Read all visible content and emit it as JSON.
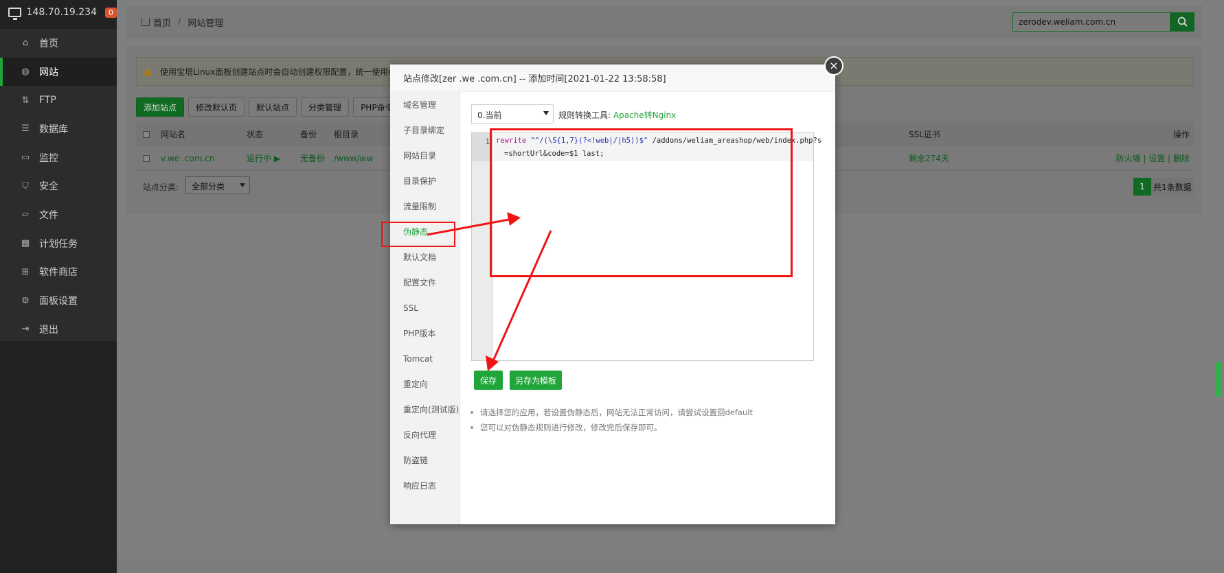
{
  "sidebar": {
    "server_ip": "148.70.19.234",
    "badge": "0",
    "items": [
      {
        "label": "首页",
        "icon": "home-icon"
      },
      {
        "label": "网站",
        "icon": "globe-icon"
      },
      {
        "label": "FTP",
        "icon": "ftp-icon"
      },
      {
        "label": "数据库",
        "icon": "database-icon"
      },
      {
        "label": "监控",
        "icon": "monitor-icon"
      },
      {
        "label": "安全",
        "icon": "shield-icon"
      },
      {
        "label": "文件",
        "icon": "folder-icon"
      },
      {
        "label": "计划任务",
        "icon": "calendar-icon"
      },
      {
        "label": "软件商店",
        "icon": "grid-icon"
      },
      {
        "label": "面板设置",
        "icon": "settings-icon"
      },
      {
        "label": "退出",
        "icon": "logout-icon"
      }
    ],
    "active_item": "网站"
  },
  "header": {
    "breadcrumb_home": "首页",
    "breadcrumb_sep": "/",
    "breadcrumb_current": "网站管理",
    "search_value": "zerodev.weliam.com.cn"
  },
  "main": {
    "warning": "使用宝塔Linux面板创建站点时会自动创建权限配置，统一使用www用",
    "toolbar": [
      "添加站点",
      "修改默认页",
      "默认站点",
      "分类管理",
      "PHP命令行版本"
    ],
    "table_headers": {
      "name": "网站名",
      "status": "状态",
      "backup": "备份",
      "root": "根目录",
      "ssl": "SSL证书",
      "actions": "操作"
    },
    "row": {
      "name": "v.we   .com.cn",
      "status": "运行中 ▶",
      "backup": "无备份",
      "root": "/www/ww",
      "ssl": "剩余274天",
      "actions": "防火墙 | 设置 | 删除"
    },
    "category_label": "站点分类:",
    "category_value": "全部分类",
    "page_number": "1",
    "total": "共1条数据"
  },
  "modal": {
    "title": "站点修改[zer      .we     .com.cn] -- 添加时间[2021-01-22 13:58:58]",
    "close": "×",
    "nav": [
      "域名管理",
      "子目录绑定",
      "网站目录",
      "目录保护",
      "流量限制",
      "伪静态",
      "默认文档",
      "配置文件",
      "SSL",
      "PHP版本",
      "Tomcat",
      "重定向",
      "重定向(测试版)",
      "反向代理",
      "防盗链",
      "响应日志"
    ],
    "active_nav": "伪静态",
    "version_select": "0.当前",
    "convert_label": "规则转换工具:",
    "convert_link": "Apache转Nginx",
    "editor": {
      "line_number": "1",
      "kw": "rewrite",
      "pattern": "\"^/(\\S{1,7}(?<!web|/|h5))$\"",
      "path": " /addons/weliam_areashop/web/index.php?s",
      "continuation": "=shortUrl&code=$1 last;"
    },
    "save_label": "保存",
    "save_template_label": "另存为模板",
    "tips": [
      "请选择您的应用，若设置伪静态后，网站无法正常访问，请尝试设置回default",
      "您可以对伪静态规则进行修改，修改完后保存即可。"
    ]
  }
}
